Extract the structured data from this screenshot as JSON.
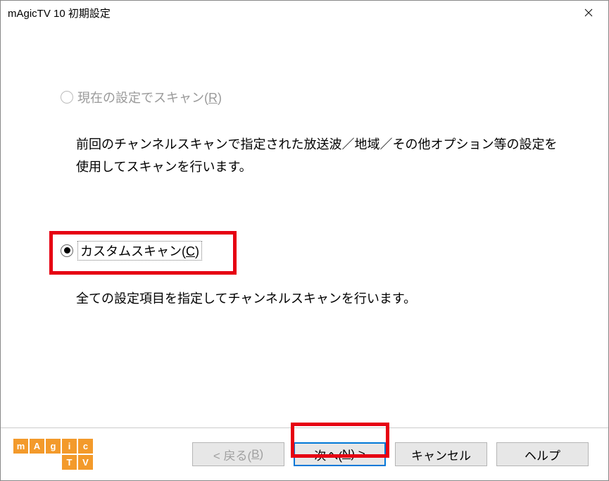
{
  "window": {
    "title": "mAgicTV 10 初期設定"
  },
  "options": {
    "current": {
      "label_pre": "現在の設定でスキャン(",
      "label_key": "R",
      "label_post": ")",
      "desc": "前回のチャンネルスキャンで指定された放送波／地域／その他オプション等の設定を使用してスキャンを行います。"
    },
    "custom": {
      "label_pre": "カスタムスキャン(",
      "label_key": "C",
      "label_post": ")",
      "desc": "全ての設定項目を指定してチャンネルスキャンを行います。"
    }
  },
  "buttons": {
    "back_pre": "< 戻る(",
    "back_key": "B",
    "back_post": ")",
    "next_pre": "次へ(",
    "next_key": "N",
    "next_post": ") >",
    "cancel": "キャンセル",
    "help": "ヘルプ"
  },
  "logo": {
    "row1": [
      "m",
      "A",
      "g",
      "i",
      "c"
    ],
    "row2": [
      "T",
      "V"
    ]
  }
}
